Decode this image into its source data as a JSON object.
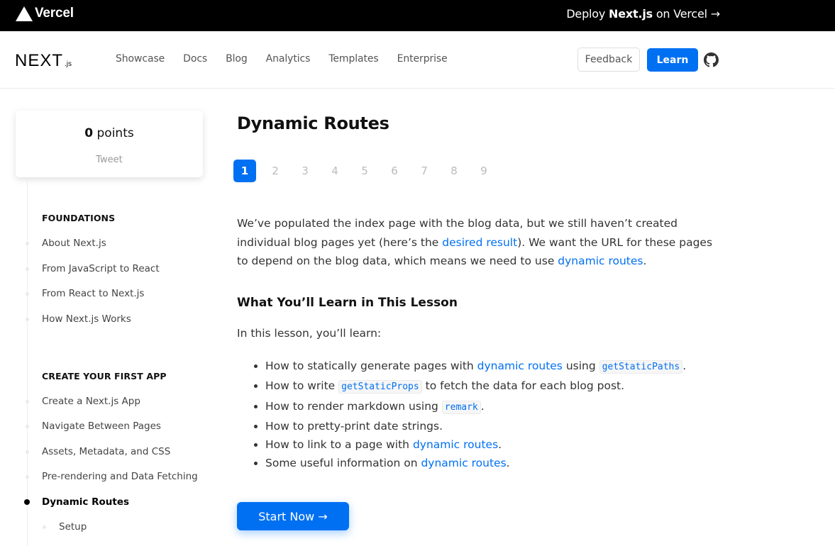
{
  "banner": {
    "brand": "Vercel",
    "deploy_prefix": "Deploy ",
    "deploy_bold": "Next.js",
    "deploy_suffix": " on Vercel →"
  },
  "nav": {
    "logo_text": "NEXT",
    "logo_suffix": ".js",
    "links": [
      "Showcase",
      "Docs",
      "Blog",
      "Analytics",
      "Templates",
      "Enterprise"
    ],
    "feedback_label": "Feedback",
    "learn_label": "Learn",
    "github_icon": "github-icon"
  },
  "sidebar": {
    "points_value": "0",
    "points_label": " points",
    "tweet_label": "Tweet",
    "sections": [
      {
        "heading": "FOUNDATIONS",
        "items": [
          "About Next.js",
          "From JavaScript to React",
          "From React to Next.js",
          "How Next.js Works"
        ]
      },
      {
        "heading": "CREATE YOUR FIRST APP",
        "items": [
          "Create a Next.js App",
          "Navigate Between Pages",
          "Assets, Metadata, and CSS",
          "Pre-rendering and Data Fetching",
          "Dynamic Routes"
        ],
        "active_item": "Dynamic Routes",
        "sub_items": [
          "Setup"
        ]
      }
    ]
  },
  "main": {
    "title": "Dynamic Routes",
    "steps": [
      "1",
      "2",
      "3",
      "4",
      "5",
      "6",
      "7",
      "8",
      "9"
    ],
    "active_step": "1",
    "para": {
      "t1": "We’ve populated the index page with the blog data, but we still haven’t created individual blog pages yet (here’s the ",
      "link1": "desired result",
      "t2": "). We want the URL for these pages to depend on the blog data, which means we need to use ",
      "link2": "dynamic routes",
      "t3": "."
    },
    "subheading": "What You’ll Learn in This Lesson",
    "intro": "In this lesson, you’ll learn:",
    "bullets": {
      "b1": {
        "t1": "How to statically generate pages with ",
        "link": "dynamic routes",
        "t2": " using ",
        "code": "getStaticPaths",
        "t3": "."
      },
      "b2": {
        "t1": "How to write ",
        "code": "getStaticProps",
        "t2": " to fetch the data for each blog post."
      },
      "b3": {
        "t1": "How to render markdown using ",
        "code": "remark",
        "t2": "."
      },
      "b4": {
        "t1": "How to pretty-print date strings."
      },
      "b5": {
        "t1": "How to link to a page with ",
        "link": "dynamic routes",
        "t2": "."
      },
      "b6": {
        "t1": "Some useful information on ",
        "link": "dynamic routes",
        "t2": "."
      }
    },
    "start_button": "Start Now →"
  },
  "colors": {
    "accent": "#0070f3",
    "banner_bg": "#000000"
  }
}
